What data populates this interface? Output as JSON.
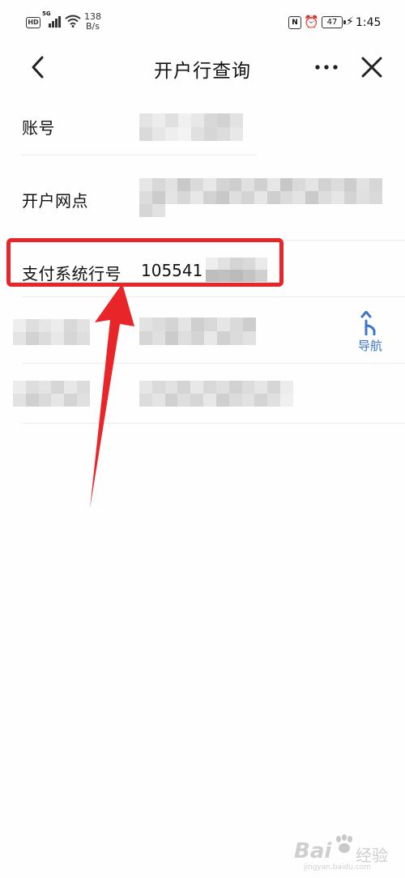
{
  "status_bar": {
    "hd": "HD",
    "signal_gen": "5G",
    "net_speed_value": "138",
    "net_speed_unit": "B/s",
    "nfc": "N",
    "battery": "47",
    "time": "1:45"
  },
  "header": {
    "title": "开户行查询",
    "back_icon": "chevron-left-icon",
    "more_icon": "more-dots-icon",
    "close_icon": "close-icon"
  },
  "rows": {
    "account_label": "账号",
    "branch_label": "开户网点",
    "payment_code_label": "支付系统行号",
    "payment_code_value": "105541"
  },
  "navigate": {
    "label": "导航",
    "icon": "turn-arrow-icon"
  },
  "colors": {
    "highlight": "#e8262a",
    "link": "#3f74c9"
  },
  "watermark": {
    "brand": "Bai",
    "brand_suffix": "经验",
    "url": "jingyan.baidu.com"
  }
}
